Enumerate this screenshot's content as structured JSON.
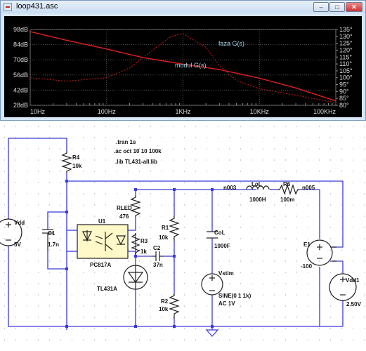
{
  "window": {
    "title": "loop431.asc"
  },
  "controls": {
    "minimize": "–",
    "maximize": "□",
    "close": "✕"
  },
  "icons": {
    "app": "ltspice-plot-icon",
    "minimize": "minimize-icon",
    "maximize": "maximize-icon",
    "close": "close-icon"
  },
  "colors": {
    "trace_magnitude": "#e02020",
    "trace_phase": "#c01818",
    "plot_bg": "#000000",
    "schematic_wire": "#3a3ad8"
  },
  "chart_data": {
    "type": "line",
    "x_ticks": [
      "10Hz",
      "100Hz",
      "1KHz",
      "10KHz",
      "100KHz"
    ],
    "x_values": [
      10,
      100,
      1000,
      10000,
      100000
    ],
    "x_scale": "log",
    "y_left_ticks": [
      "98dB",
      "84dB",
      "70dB",
      "56dB",
      "42dB",
      "28dB"
    ],
    "y_left_values": [
      98,
      84,
      70,
      56,
      42,
      28
    ],
    "y_right_ticks": [
      "135°",
      "130°",
      "125°",
      "120°",
      "115°",
      "110°",
      "105°",
      "100°",
      "95°",
      "90°",
      "85°",
      "80°"
    ],
    "y_right_values": [
      135,
      130,
      125,
      120,
      115,
      110,
      105,
      100,
      95,
      90,
      85,
      80
    ],
    "series": [
      {
        "name": "modul G(s)",
        "axis": "left",
        "style": "solid",
        "x": [
          10,
          30,
          100,
          300,
          1000,
          3000,
          10000,
          30000,
          100000
        ],
        "y": [
          96,
          88,
          80,
          72,
          66,
          61,
          53,
          44,
          32
        ]
      },
      {
        "name": "faza G(s)",
        "axis": "right",
        "style": "dashed",
        "x": [
          10,
          30,
          100,
          200,
          400,
          700,
          1000,
          2000,
          3000,
          5000,
          10000,
          20000,
          40000,
          100000
        ],
        "y": [
          100,
          97.5,
          100,
          107,
          120,
          130,
          132,
          122,
          109,
          98,
          92,
          89,
          86,
          82
        ]
      }
    ]
  },
  "schematic": {
    "directives": [
      ".tran 1s",
      ".ac oct 10 10 100k",
      ".lib TL431-all.lib"
    ],
    "nets": {
      "n003": "n003",
      "n005": "n005"
    },
    "components": {
      "R4": {
        "name": "R4",
        "value": "10k"
      },
      "RLED": {
        "name": "RLED",
        "value": "476"
      },
      "R3": {
        "name": "R3",
        "value": "1k"
      },
      "C2": {
        "name": "C2",
        "value": "37n"
      },
      "R1": {
        "name": "R1",
        "value": "10k"
      },
      "R2": {
        "name": "R2",
        "value": "10k"
      },
      "C1": {
        "name": "C1",
        "value": "1.7n"
      },
      "U1": {
        "name": "U1",
        "value": "PC817A"
      },
      "U2": {
        "value": "TL431A"
      },
      "LoL": {
        "name": "LoL",
        "value": "1000H"
      },
      "R6": {
        "name": "R6",
        "value": "100m"
      },
      "CoL": {
        "name": "CoL",
        "value": "1000F"
      },
      "Vstim": {
        "name": "Vstim",
        "value": "SINE(0 1 1k)",
        "value2": "AC 1V"
      },
      "E1": {
        "name": "E1",
        "value": "-100"
      },
      "Vdd": {
        "name": "Vdd",
        "value": "5V"
      },
      "Vdd1": {
        "name": "Vdd1",
        "value": "2.50V"
      }
    }
  }
}
